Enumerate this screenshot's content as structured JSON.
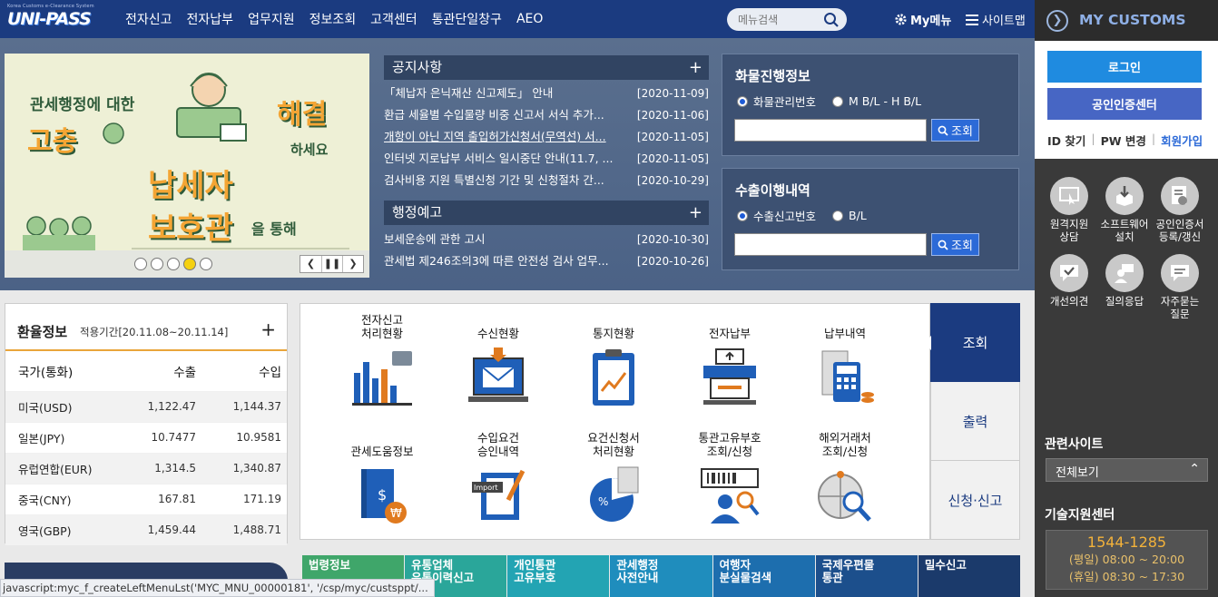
{
  "logo": {
    "tagline": "Korea Customs e-Clearance System",
    "name": "UNI-PASS"
  },
  "nav": [
    "전자신고",
    "전자납부",
    "업무지원",
    "정보조회",
    "고객센터",
    "통관단일창구",
    "AEO"
  ],
  "menu_search": {
    "placeholder": "메뉴검색"
  },
  "top_links": {
    "mymenu": "My메뉴",
    "sitemap": "사이트맵"
  },
  "banner": {
    "line1": "관세행정에 대한",
    "word1": "고충",
    "word2": "해결",
    "line2": "하세요",
    "big1": "납세자",
    "big2": "보호관",
    "suffix": "을 통해"
  },
  "notice": {
    "title": "공지사항",
    "items": [
      {
        "text": "「체납자 은닉재산 신고제도」 안내",
        "date": "[2020-11-09]"
      },
      {
        "text": "환급 세율별 수입물량 비중 신고서 서식 추가...",
        "date": "[2020-11-06]"
      },
      {
        "text": "개항이 아닌 지역 출입허가신청서(무역선) 서...",
        "date": "[2020-11-05]"
      },
      {
        "text": "인터넷 지로납부 서비스 일시중단 안내(11.7, ...",
        "date": "[2020-11-05]"
      },
      {
        "text": "검사비용 지원 특별신청 기간 및 신청절차 간...",
        "date": "[2020-10-29]"
      }
    ]
  },
  "admin_notice": {
    "title": "행정예고",
    "items": [
      {
        "text": "보세운송에 관한 고시",
        "date": "[2020-10-30]"
      },
      {
        "text": "관세법 제246조의3에 따른 안전성 검사 업무...",
        "date": "[2020-10-26]"
      }
    ]
  },
  "cargo": {
    "title": "화물진행정보",
    "opt1": "화물관리번호",
    "opt2": "M B/L - H B/L",
    "button": "조회"
  },
  "export": {
    "title": "수출이행내역",
    "opt1": "수출신고번호",
    "opt2": "B/L",
    "button": "조회"
  },
  "rates": {
    "title": "환율정보",
    "period": "적용기간[20.11.08~20.11.14]",
    "headers": [
      "국가(통화)",
      "수출",
      "수입"
    ],
    "rows": [
      {
        "country": "미국(USD)",
        "export": "1,122.47",
        "import": "1,144.37"
      },
      {
        "country": "일본(JPY)",
        "export": "10.7477",
        "import": "10.9581"
      },
      {
        "country": "유럽연합(EUR)",
        "export": "1,314.5",
        "import": "1,340.87"
      },
      {
        "country": "중국(CNY)",
        "export": "167.81",
        "import": "171.19"
      },
      {
        "country": "영국(GBP)",
        "export": "1,459.44",
        "import": "1,488.71"
      }
    ]
  },
  "services": [
    {
      "label1": "전자신고",
      "label2": "처리현황"
    },
    {
      "label1": "",
      "label2": "수신현황"
    },
    {
      "label1": "",
      "label2": "통지현황"
    },
    {
      "label1": "",
      "label2": "전자납부"
    },
    {
      "label1": "",
      "label2": "납부내역"
    },
    {
      "label1": "",
      "label2": "관세도움정보"
    },
    {
      "label1": "수입요건",
      "label2": "승인내역"
    },
    {
      "label1": "요건신청서",
      "label2": "처리현황"
    },
    {
      "label1": "통관고유부호",
      "label2": "조회/신청"
    },
    {
      "label1": "해외거래처",
      "label2": "조회/신청"
    }
  ],
  "tabs": [
    "조회",
    "출력",
    "신청·신고"
  ],
  "quick": [
    {
      "l1": "법령정보",
      "l2": "",
      "color": "#3fa66a"
    },
    {
      "l1": "유통업체",
      "l2": "유통이력신고",
      "color": "#2aa69a"
    },
    {
      "l1": "개인통관",
      "l2": "고유부호",
      "color": "#23a4b3"
    },
    {
      "l1": "관세행정",
      "l2": "사전안내",
      "color": "#1f8dbd"
    },
    {
      "l1": "여행자",
      "l2": "분실물검색",
      "color": "#1d6eae"
    },
    {
      "l1": "국제우편물",
      "l2": "통관",
      "color": "#1c4f8c"
    },
    {
      "l1": "밀수신고",
      "l2": "",
      "color": "#1b3a6b"
    }
  ],
  "statusbar": "javascript:myc_f_createLeftMenuLst('MYC_MNU_00000181', '/csp/myc/custsppt/...",
  "sidebar": {
    "title": "MY CUSTOMS",
    "login": "로그인",
    "cert": "공인인증센터",
    "id_find": "ID 찾기",
    "pw_change": "PW 변경",
    "join": "회원가입",
    "icons": [
      {
        "l1": "원격지원",
        "l2": "상담"
      },
      {
        "l1": "소프트웨어",
        "l2": "설치"
      },
      {
        "l1": "공인인증서",
        "l2": "등록/갱신"
      },
      {
        "l1": "개선의견",
        "l2": ""
      },
      {
        "l1": "질의응답",
        "l2": ""
      },
      {
        "l1": "자주묻는",
        "l2": "질문"
      }
    ],
    "related_title": "관련사이트",
    "related_select": "전체보기",
    "support_title": "기술지원센터",
    "phone": "1544-1285",
    "weekday": "(평일) 08:00 ~ 20:00",
    "holiday": "(휴일) 08:30 ~ 17:30"
  },
  "colors": {
    "nav": "#1b3b80",
    "hero": "#5a6f8e",
    "accent": "#2c6ad7",
    "login": "#1f8be0",
    "cert": "#4766c4",
    "phone": "#f3b23a"
  }
}
